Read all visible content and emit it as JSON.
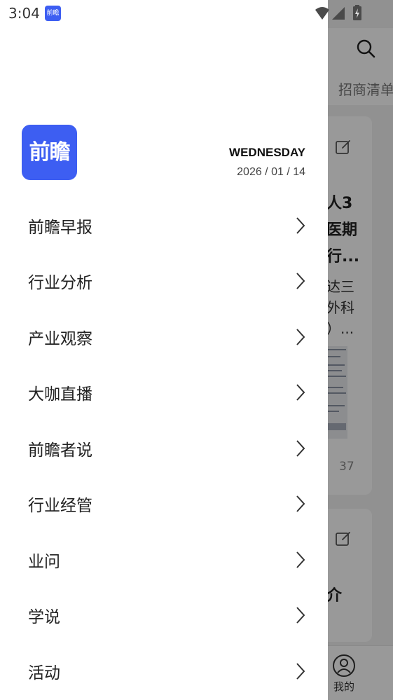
{
  "status_bar": {
    "time": "3:04",
    "app_icon_text": "前瞻"
  },
  "drawer": {
    "logo_text": "前瞻",
    "weekday": "WEDNESDAY",
    "date": "2026 / 01 / 14",
    "menu_items": [
      {
        "label": "前瞻早报"
      },
      {
        "label": "行业分析"
      },
      {
        "label": "产业观察"
      },
      {
        "label": "大咖直播"
      },
      {
        "label": "前瞻者说"
      },
      {
        "label": "行业经管"
      },
      {
        "label": "业问"
      },
      {
        "label": "学说"
      },
      {
        "label": "活动"
      }
    ]
  },
  "background": {
    "tab_label": "招商清单",
    "card1_title_lines": [
      "人3",
      "医期",
      "行..."
    ],
    "card1_text_lines": [
      "达三",
      "外科",
      "）..."
    ],
    "card1_count": "37",
    "card2_title": "介",
    "bottom_nav_profile": "我的"
  },
  "colors": {
    "brand": "#3d5ef2",
    "scrim": "rgba(0,0,0,0.40)"
  },
  "icons": [
    "search-icon",
    "edit-icon",
    "chevron-right-icon",
    "profile-icon",
    "wifi-icon",
    "signal-icon",
    "battery-icon"
  ]
}
